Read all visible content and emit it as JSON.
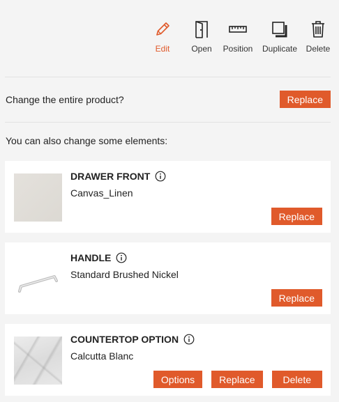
{
  "toolbar": {
    "items": [
      {
        "label": "Edit",
        "icon": "pencil-icon",
        "active": true
      },
      {
        "label": "Open",
        "icon": "door-icon"
      },
      {
        "label": "Position",
        "icon": "ruler-icon"
      },
      {
        "label": "Duplicate",
        "icon": "duplicate-icon"
      },
      {
        "label": "Delete",
        "icon": "trash-icon"
      }
    ]
  },
  "product": {
    "question": "Change the entire product?",
    "replace_label": "Replace"
  },
  "elements_intro": "You can also change some elements:",
  "elements": [
    {
      "title": "DRAWER FRONT",
      "value": "Canvas_Linen",
      "thumb": "linen-swatch",
      "actions": [
        "Replace"
      ]
    },
    {
      "title": "HANDLE",
      "value": "Standard Brushed Nickel",
      "thumb": "handle-image",
      "actions": [
        "Replace"
      ]
    },
    {
      "title": "COUNTERTOP OPTION",
      "value": "Calcutta Blanc",
      "thumb": "marble-swatch",
      "actions": [
        "Options",
        "Replace",
        "Delete"
      ]
    }
  ],
  "colors": {
    "accent": "#e05a2b",
    "background": "#f4f4f4",
    "card": "#ffffff"
  }
}
